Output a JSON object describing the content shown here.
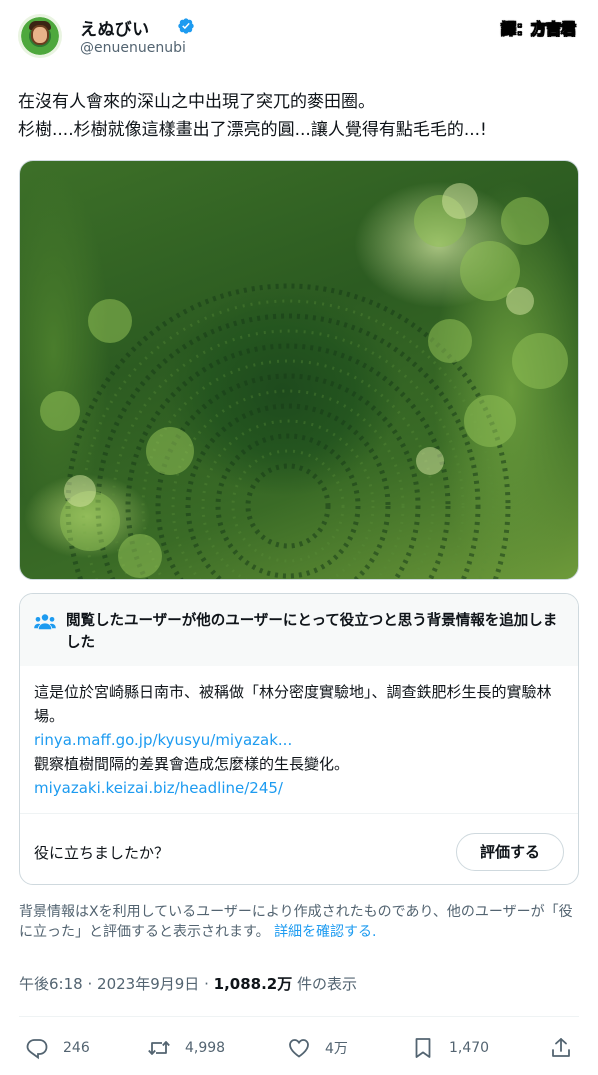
{
  "author": {
    "display_name": "えぬびい",
    "handle": "@enuenuenubi",
    "verified_icon": "verified-badge-icon",
    "verified_color": "#1d9bf0"
  },
  "watermark": "譯：方吉君",
  "tweet": {
    "line1": "在沒有人會來的深山之中出現了突兀的麥田圈。",
    "line2": "杉樹....杉樹就像這樣畫出了漂亮的圓...讓人覺得有點毛毛的...!"
  },
  "media": {
    "icon": "photo-forest-crop-circle"
  },
  "community_note": {
    "title": "閲覧したユーザーが他のユーザーにとって役立つと思う背景情報を追加しました",
    "body_line1": "這是位於宮崎縣日南市、被稱做「林分密度實驗地」、調查鉄肥杉生長的實驗林場。",
    "link1": "rinya.maff.go.jp/kyusyu/miyazak...",
    "body_line2": "觀察植樹間隔的差異會造成怎麼樣的生長變化。",
    "link2": "miyazaki.keizai.biz/headline/245/",
    "helpful_question": "役に立ちましたか？",
    "rate_button": "評価する",
    "link_color": "#1d9bf0"
  },
  "disclaimer": {
    "text": "背景情報はXを利用しているユーザーにより作成されたものであり、他のユーザーが「役に立った」と評価すると表示されます。",
    "more_link": "詳細を確認する."
  },
  "meta": {
    "time": "午後6:18",
    "separator": "·",
    "date": "2023年9月9日",
    "views_count": "1,088.2万",
    "views_label": "件の表示"
  },
  "actions": {
    "reply_count": "246",
    "retweet_count": "4,998",
    "like_count": "4万",
    "bookmark_count": "1,470"
  }
}
